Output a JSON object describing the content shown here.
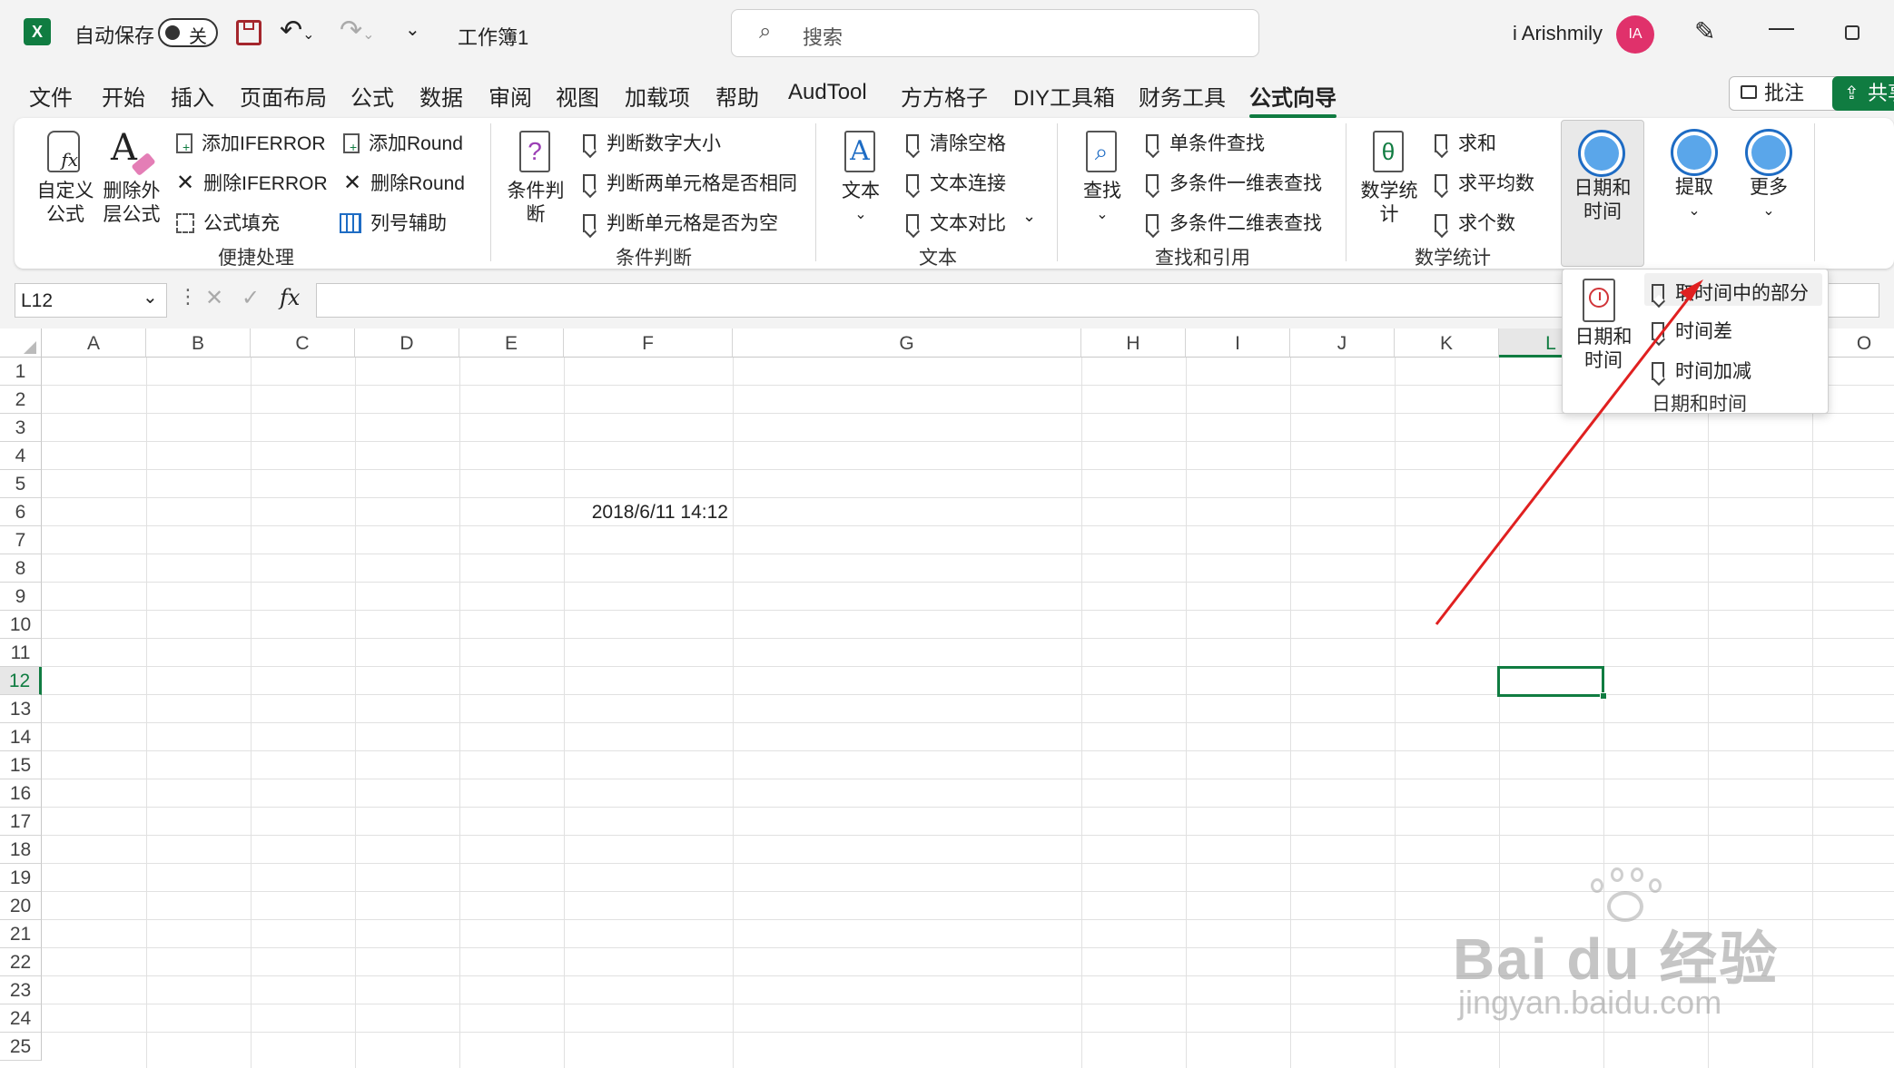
{
  "titlebar": {
    "autosave_label": "自动保存",
    "autosave_state": "关",
    "workbook_name": "工作簿1",
    "search_placeholder": "搜索",
    "user_name": "i Arishmily",
    "avatar_initials": "IA"
  },
  "menu": {
    "tabs": [
      "文件",
      "开始",
      "插入",
      "页面布局",
      "公式",
      "数据",
      "审阅",
      "视图",
      "加载项",
      "帮助",
      "AudTool",
      "方方格子",
      "DIY工具箱",
      "财务工具",
      "公式向导"
    ],
    "active_tab": "公式向导",
    "comment_button": "批注",
    "share_button": "共享"
  },
  "ribbon": {
    "quick": {
      "custom_formula": "自定义公式",
      "remove_outer": "删除外层公式",
      "add_iferror": "添加IFERROR",
      "remove_iferror": "删除IFERROR",
      "formula_fill": "公式填充",
      "add_round": "添加Round",
      "remove_round": "删除Round",
      "col_helper": "列号辅助",
      "group_label": "便捷处理"
    },
    "condition": {
      "big_label": "条件判断",
      "item1": "判断数字大小",
      "item2": "判断两单元格是否相同",
      "item3": "判断单元格是否为空",
      "group_label": "条件判断"
    },
    "text": {
      "big_label": "文本",
      "item1": "清除空格",
      "item2": "文本连接",
      "item3": "文本对比",
      "group_label": "文本"
    },
    "lookup": {
      "big_label": "查找",
      "item1": "单条件查找",
      "item2": "多条件一维表查找",
      "item3": "多条件二维表查找",
      "group_label": "查找和引用"
    },
    "math": {
      "big_label": "数学统计",
      "item1": "求和",
      "item2": "求平均数",
      "item3": "求个数",
      "group_label": "数学统计"
    },
    "date_button": "日期和时间",
    "extract_button": "提取",
    "more_button": "更多"
  },
  "formula_bar": {
    "name_box": "L12",
    "fx": "fx",
    "content": ""
  },
  "grid": {
    "columns": [
      "A",
      "B",
      "C",
      "D",
      "E",
      "F",
      "G",
      "H",
      "I",
      "J",
      "K",
      "L",
      "O"
    ],
    "rows": [
      "1",
      "2",
      "3",
      "4",
      "5",
      "6",
      "7",
      "8",
      "9",
      "10",
      "11",
      "12",
      "13",
      "14",
      "15",
      "16",
      "17",
      "18",
      "19",
      "20",
      "21",
      "22",
      "23",
      "24",
      "25"
    ],
    "cell_F6": "2018/6/11 14:12",
    "selected_cell": "L12"
  },
  "popup": {
    "big_label": "日期和时间",
    "item1": "取时间中的部分",
    "item2": "时间差",
    "item3": "时间加减",
    "group_label": "日期和时间"
  },
  "watermark": {
    "brand": "Bai du 经验",
    "url": "jingyan.baidu.com"
  },
  "colors": {
    "excel_green": "#107c41",
    "annotation_red": "#e02020",
    "avatar_pink": "#e0316b",
    "icon_blue": "#1e6cc4"
  }
}
